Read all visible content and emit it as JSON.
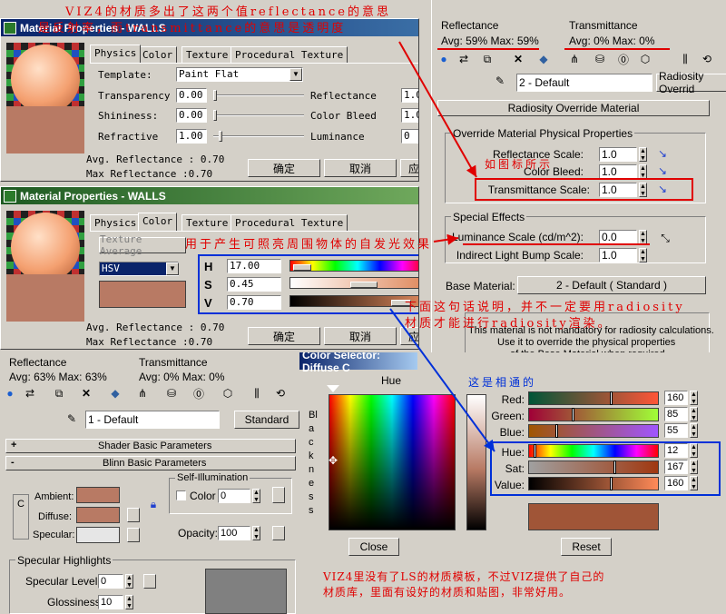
{
  "annotations": {
    "top_red": "VIZ4的材质多出了这两个值reflectance的意思",
    "top_red2": "是反射率，而transmittance的意思是透明度",
    "icon_note": "如图标所示",
    "selfillum_note": "用于产生可照亮周围物体的自发光效果",
    "radiosity_note1": "下面这句话说明，并不一定要用radiosity",
    "radiosity_note2": "材质才能进行radiosity渲染。",
    "match_note": "这是相通的",
    "bottom_note1": "VIZ4里没有了LS的材质模板，不过VIZ提供了自己的",
    "bottom_note2": "材质库，里面有设好的材质和贴图，非常好用。"
  },
  "win1": {
    "title": "Material Properties - WALLS",
    "tabs": [
      "Physics",
      "Color",
      "Texture",
      "Procedural Texture"
    ],
    "template_label": "Template:",
    "template_value": "Paint Flat",
    "transparency_label": "Transparency",
    "transparency_value": "0.00",
    "reflectance_label": "Reflectance",
    "reflectance_value": "1.0",
    "shininess_label": "Shininess:",
    "shininess_value": "0.00",
    "colorbleed_label": "Color Bleed",
    "colorbleed_value": "1.0",
    "refractive_label": "Refractive",
    "refractive_value": "1.00",
    "luminance_label": "Luminance",
    "luminance_value": "0",
    "avg_reflectance": "Avg. Reflectance : 0.70",
    "max_reflectance": "Max Reflectance :0.70",
    "ok": "确定",
    "cancel": "取消",
    "apply": "应"
  },
  "win2": {
    "title": "Material Properties - WALLS",
    "tabs": [
      "Physics",
      "Color",
      "Texture",
      "Procedural Texture"
    ],
    "texture_average": "Texture Average",
    "mode": "HSV",
    "h_label": "H",
    "h_value": "17.00",
    "s_label": "S",
    "s_value": "0.45",
    "v_label": "V",
    "v_value": "0.70",
    "avg_reflectance": "Avg. Reflectance : 0.70",
    "max_reflectance": "Max Reflectance :0.70",
    "ok": "确定",
    "cancel": "取消",
    "apply": "应"
  },
  "panel_right": {
    "reflectance_label": "Reflectance",
    "reflectance_values": "Avg:  59% Max:  59%",
    "transmittance_label": "Transmittance",
    "transmittance_values": "Avg:    0% Max:    0%",
    "material_name": "2 - Default",
    "radiosity_override_btn": "Radiosity Overrid",
    "rollout_title": "Radiosity Override Material",
    "group1_title": "Override Material Physical Properties",
    "reflectance_scale_label": "Reflectance Scale:",
    "reflectance_scale_value": "1.0",
    "color_bleed_label": "Color Bleed:",
    "color_bleed_value": "1.0",
    "transmittance_scale_label": "Transmittance Scale:",
    "transmittance_scale_value": "1.0",
    "group2_title": "Special Effects",
    "luminance_scale_label": "Luminance Scale (cd/m^2):",
    "luminance_scale_value": "0.0",
    "indirect_bump_label": "Indirect Light Bump Scale:",
    "indirect_bump_value": "1.0",
    "base_material_label": "Base Material:",
    "base_material_value": "2 - Default  ( Standard )",
    "info1": "This material is not mandatory for radiosity calculations.",
    "info2": "Use it to override the physical properties",
    "info3": "of the Base Material when required."
  },
  "panel_left": {
    "reflectance_label": "Reflectance",
    "reflectance_values": "Avg:  63% Max:  63%",
    "transmittance_label": "Transmittance",
    "transmittance_values": "Avg:    0% Max:    0%",
    "material_name": "1 - Default",
    "type_button": "Standard",
    "shader_rollout": "Shader Basic Parameters",
    "blinn_rollout": "Blinn Basic Parameters",
    "self_illum_title": "Self-Illumination",
    "color_check_label": "Color",
    "color_value": "0",
    "ambient_label": "Ambient:",
    "diffuse_label": "Diffuse:",
    "specular_label": "Specular:",
    "opacity_label": "Opacity:",
    "opacity_value": "100",
    "spec_highlights_title": "Specular Highlights",
    "spec_level_label": "Specular Level:",
    "spec_level_value": "0",
    "glossiness_label": "Glossiness:",
    "glossiness_value": "10"
  },
  "color_selector": {
    "title": "Color Selector: Diffuse C",
    "hue_label": "Hue",
    "blackness_label": "Blackness",
    "red_label": "Red:",
    "red_value": "160",
    "green_label": "Green:",
    "green_value": "85",
    "blue_label": "Blue:",
    "blue_value": "55",
    "hue2_label": "Hue:",
    "hue2_value": "12",
    "sat_label": "Sat:",
    "sat_value": "167",
    "value_label": "Value:",
    "value_value": "160",
    "close": "Close",
    "reset": "Reset"
  },
  "colors": {
    "material": "#b87a64",
    "annotation_red": "#e00000",
    "annotation_blue": "#0030d8"
  }
}
